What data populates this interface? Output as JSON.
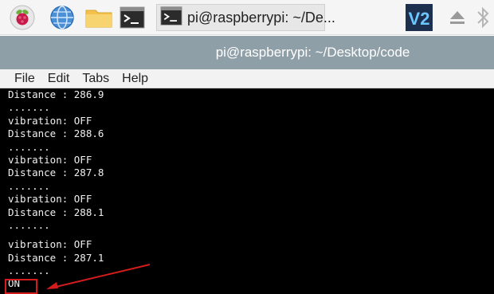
{
  "taskbar": {
    "window_label": "pi@raspberrypi: ~/De...",
    "vnc_label": "V2"
  },
  "window": {
    "title": "pi@raspberrypi: ~/Desktop/code"
  },
  "menu": {
    "items": [
      "File",
      "Edit",
      "Tabs",
      "Help"
    ]
  },
  "terminal": {
    "lines": [
      "Distance : 286.9",
      ".......",
      "vibration: OFF",
      "Distance : 288.6",
      ".......",
      "vibration: OFF",
      "Distance : 287.8",
      ".......",
      "vibration: OFF",
      "Distance : 288.1",
      ".......",
      "vibration: OFF",
      "Distance : 287.1",
      ".......",
      "ON"
    ]
  },
  "colors": {
    "titlebar": "#8f9fa7",
    "terminal_bg": "#000000",
    "terminal_fg": "#f0f0f0",
    "annotation": "#d41c1c"
  }
}
